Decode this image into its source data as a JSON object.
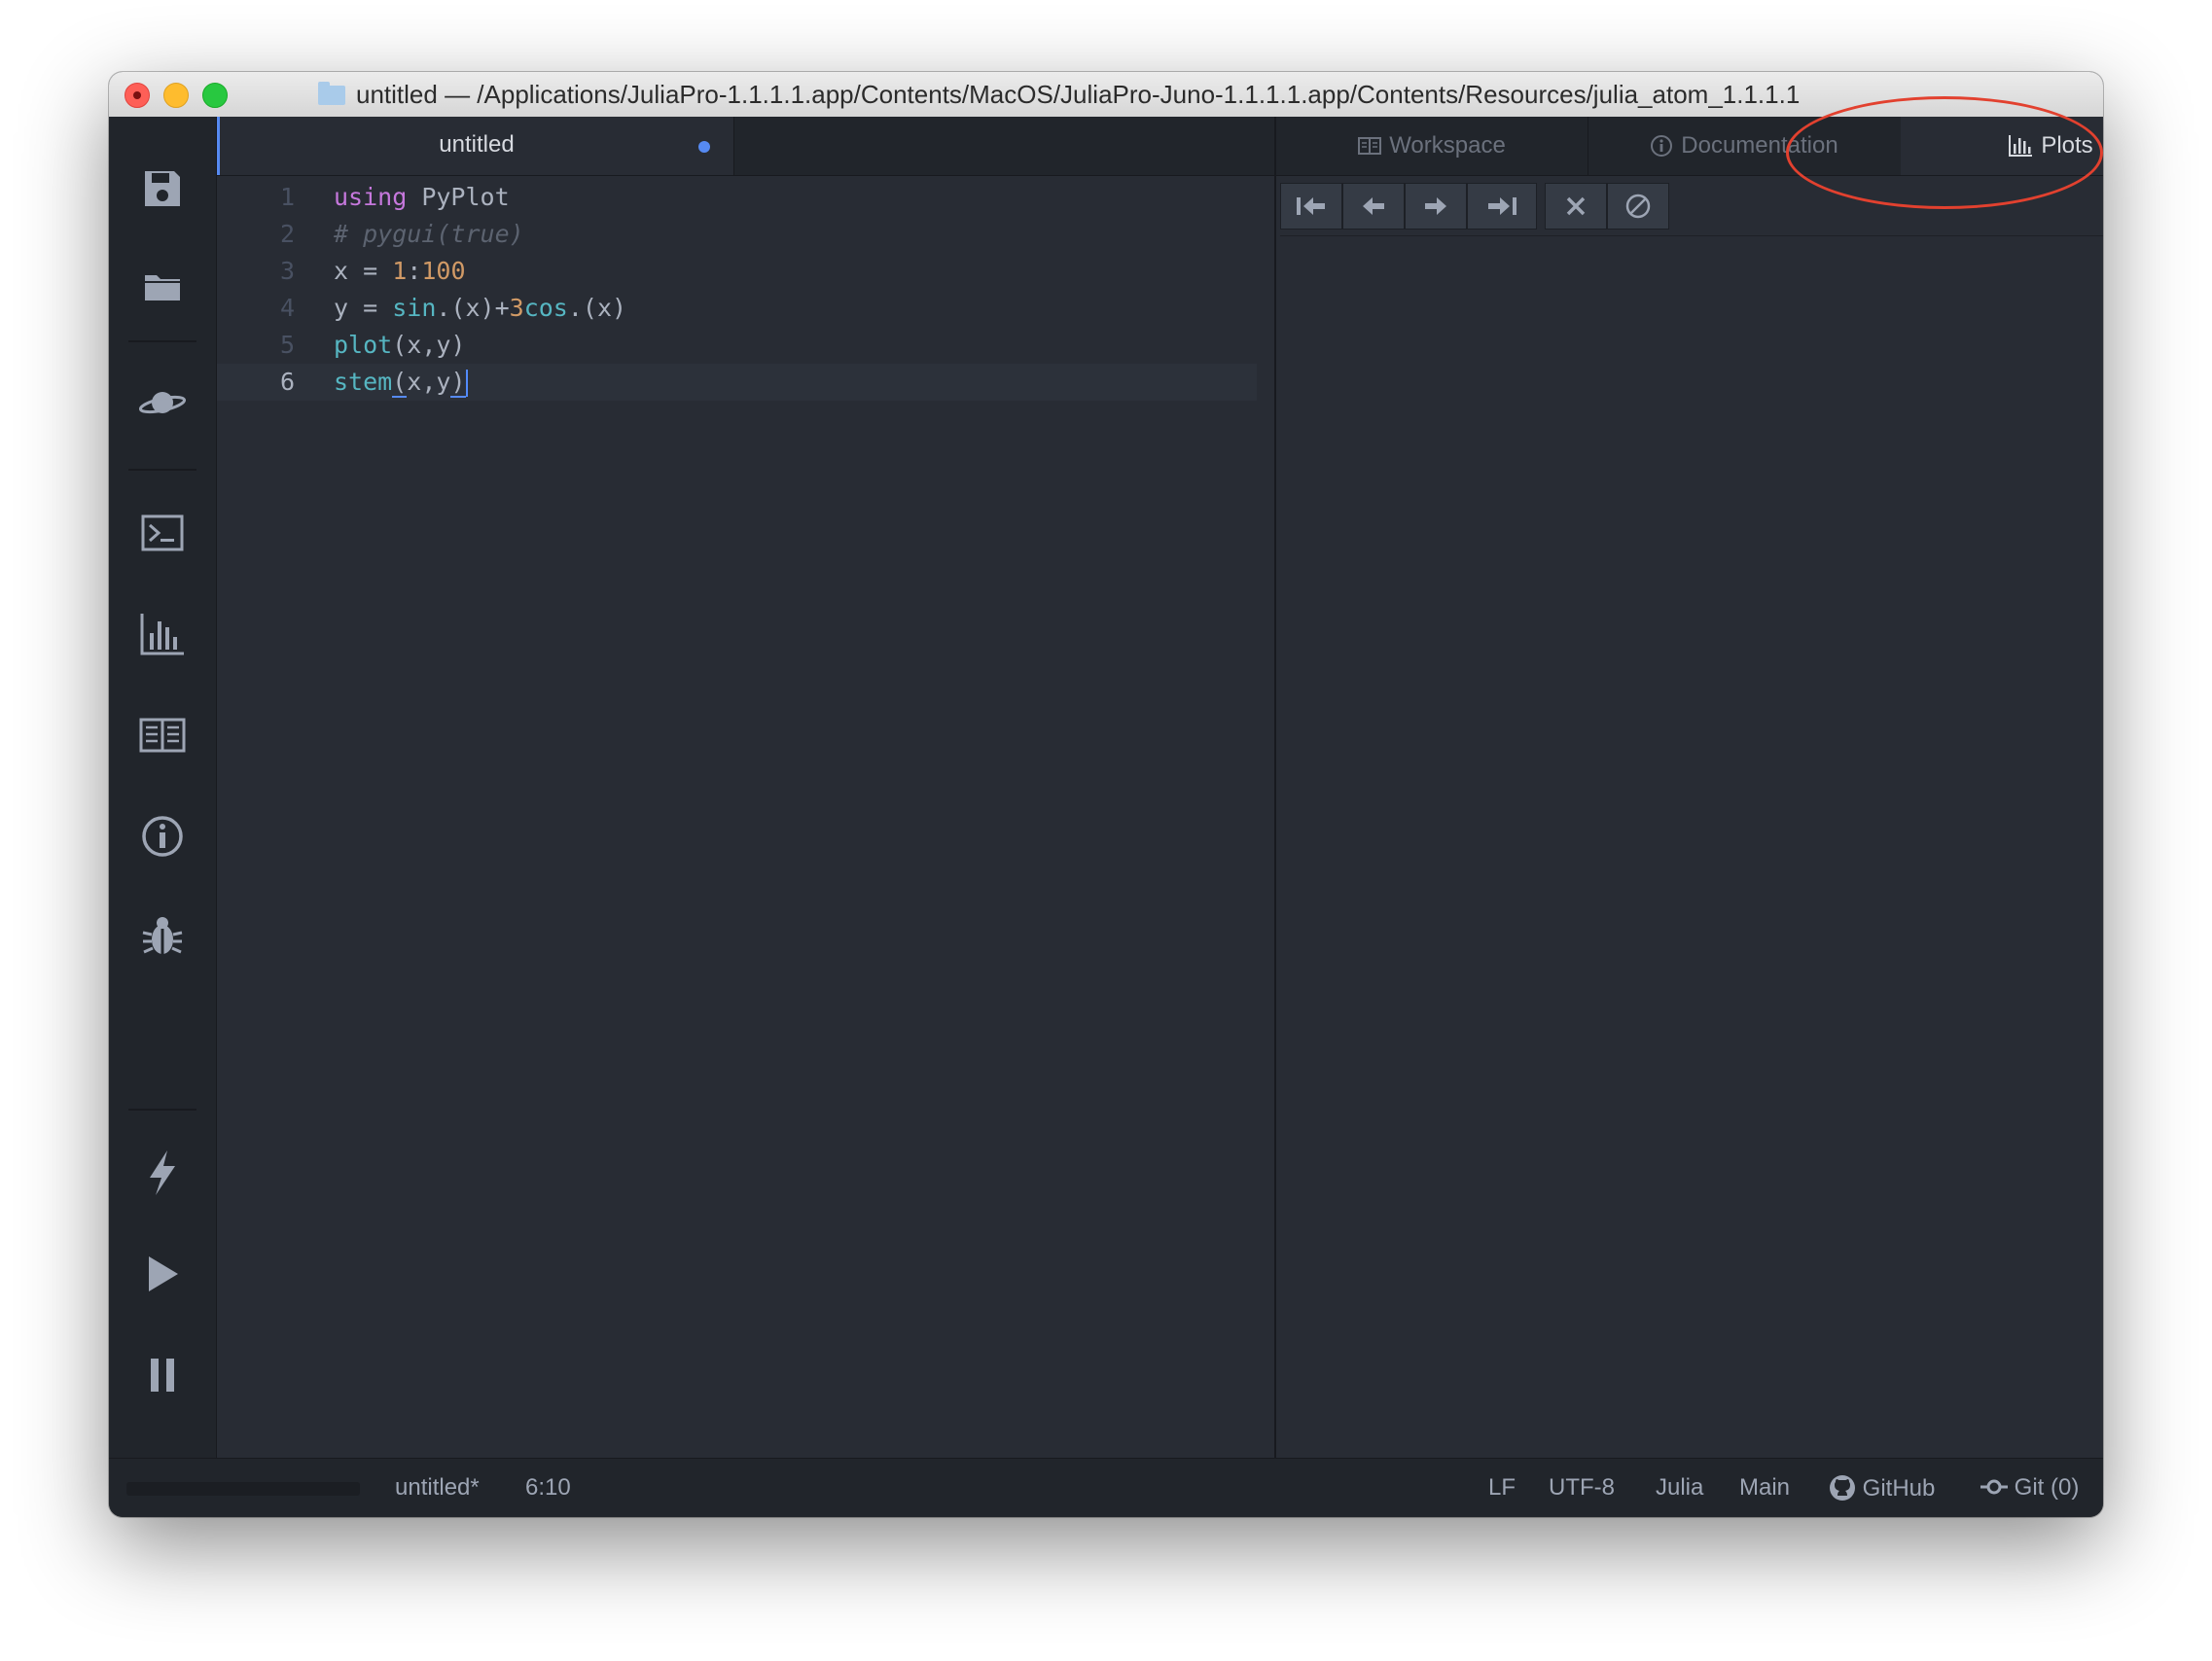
{
  "window": {
    "title": "untitled — /Applications/JuliaPro-1.1.1.1.app/Contents/MacOS/JuliaPro-Juno-1.1.1.1.app/Contents/Resources/julia_atom_1.1.1.1"
  },
  "toolbar": {
    "buttons": [
      "save-icon",
      "folder-icon",
      "planet-icon",
      "terminal-icon",
      "plots-icon",
      "book-icon",
      "info-icon",
      "bug-icon",
      "lightning-icon",
      "play-icon",
      "pause-icon",
      "stop-icon"
    ]
  },
  "editor": {
    "tab_title": "untitled",
    "lines": [
      {
        "num": "1",
        "parts": [
          [
            "kw",
            "using"
          ],
          [
            "",
            " PyPlot"
          ]
        ]
      },
      {
        "num": "2",
        "parts": [
          [
            "cm",
            "# pygui(true)"
          ]
        ]
      },
      {
        "num": "3",
        "parts": [
          [
            "",
            "x = "
          ],
          [
            "num",
            "1"
          ],
          [
            "",
            ":"
          ],
          [
            "num",
            "100"
          ]
        ]
      },
      {
        "num": "4",
        "parts": [
          [
            "",
            "y = "
          ],
          [
            "fn",
            "sin"
          ],
          [
            "",
            ".(x)+"
          ],
          [
            "num",
            "3"
          ],
          [
            "fn",
            "cos"
          ],
          [
            "",
            ".(x)"
          ]
        ]
      },
      {
        "num": "5",
        "parts": [
          [
            "fn",
            "plot"
          ],
          [
            "",
            "(x,y)"
          ]
        ]
      },
      {
        "num": "6",
        "parts": [
          [
            "fn",
            "stem"
          ],
          [
            "ul",
            "("
          ],
          [
            "",
            "x,y"
          ],
          [
            "ul",
            ")"
          ]
        ]
      }
    ],
    "current_line": 6
  },
  "panel": {
    "tabs": {
      "workspace": "Workspace",
      "documentation": "Documentation",
      "plots": "Plots"
    },
    "active_tab": "Plots"
  },
  "statusbar": {
    "file": "untitled*",
    "cursor": "6:10",
    "line_ending": "LF",
    "encoding": "UTF-8",
    "grammar": "Julia",
    "module": "Main",
    "github": "GitHub",
    "git": "Git (0)"
  },
  "colors": {
    "accent": "#568af2",
    "annotation": "#e2412f"
  }
}
